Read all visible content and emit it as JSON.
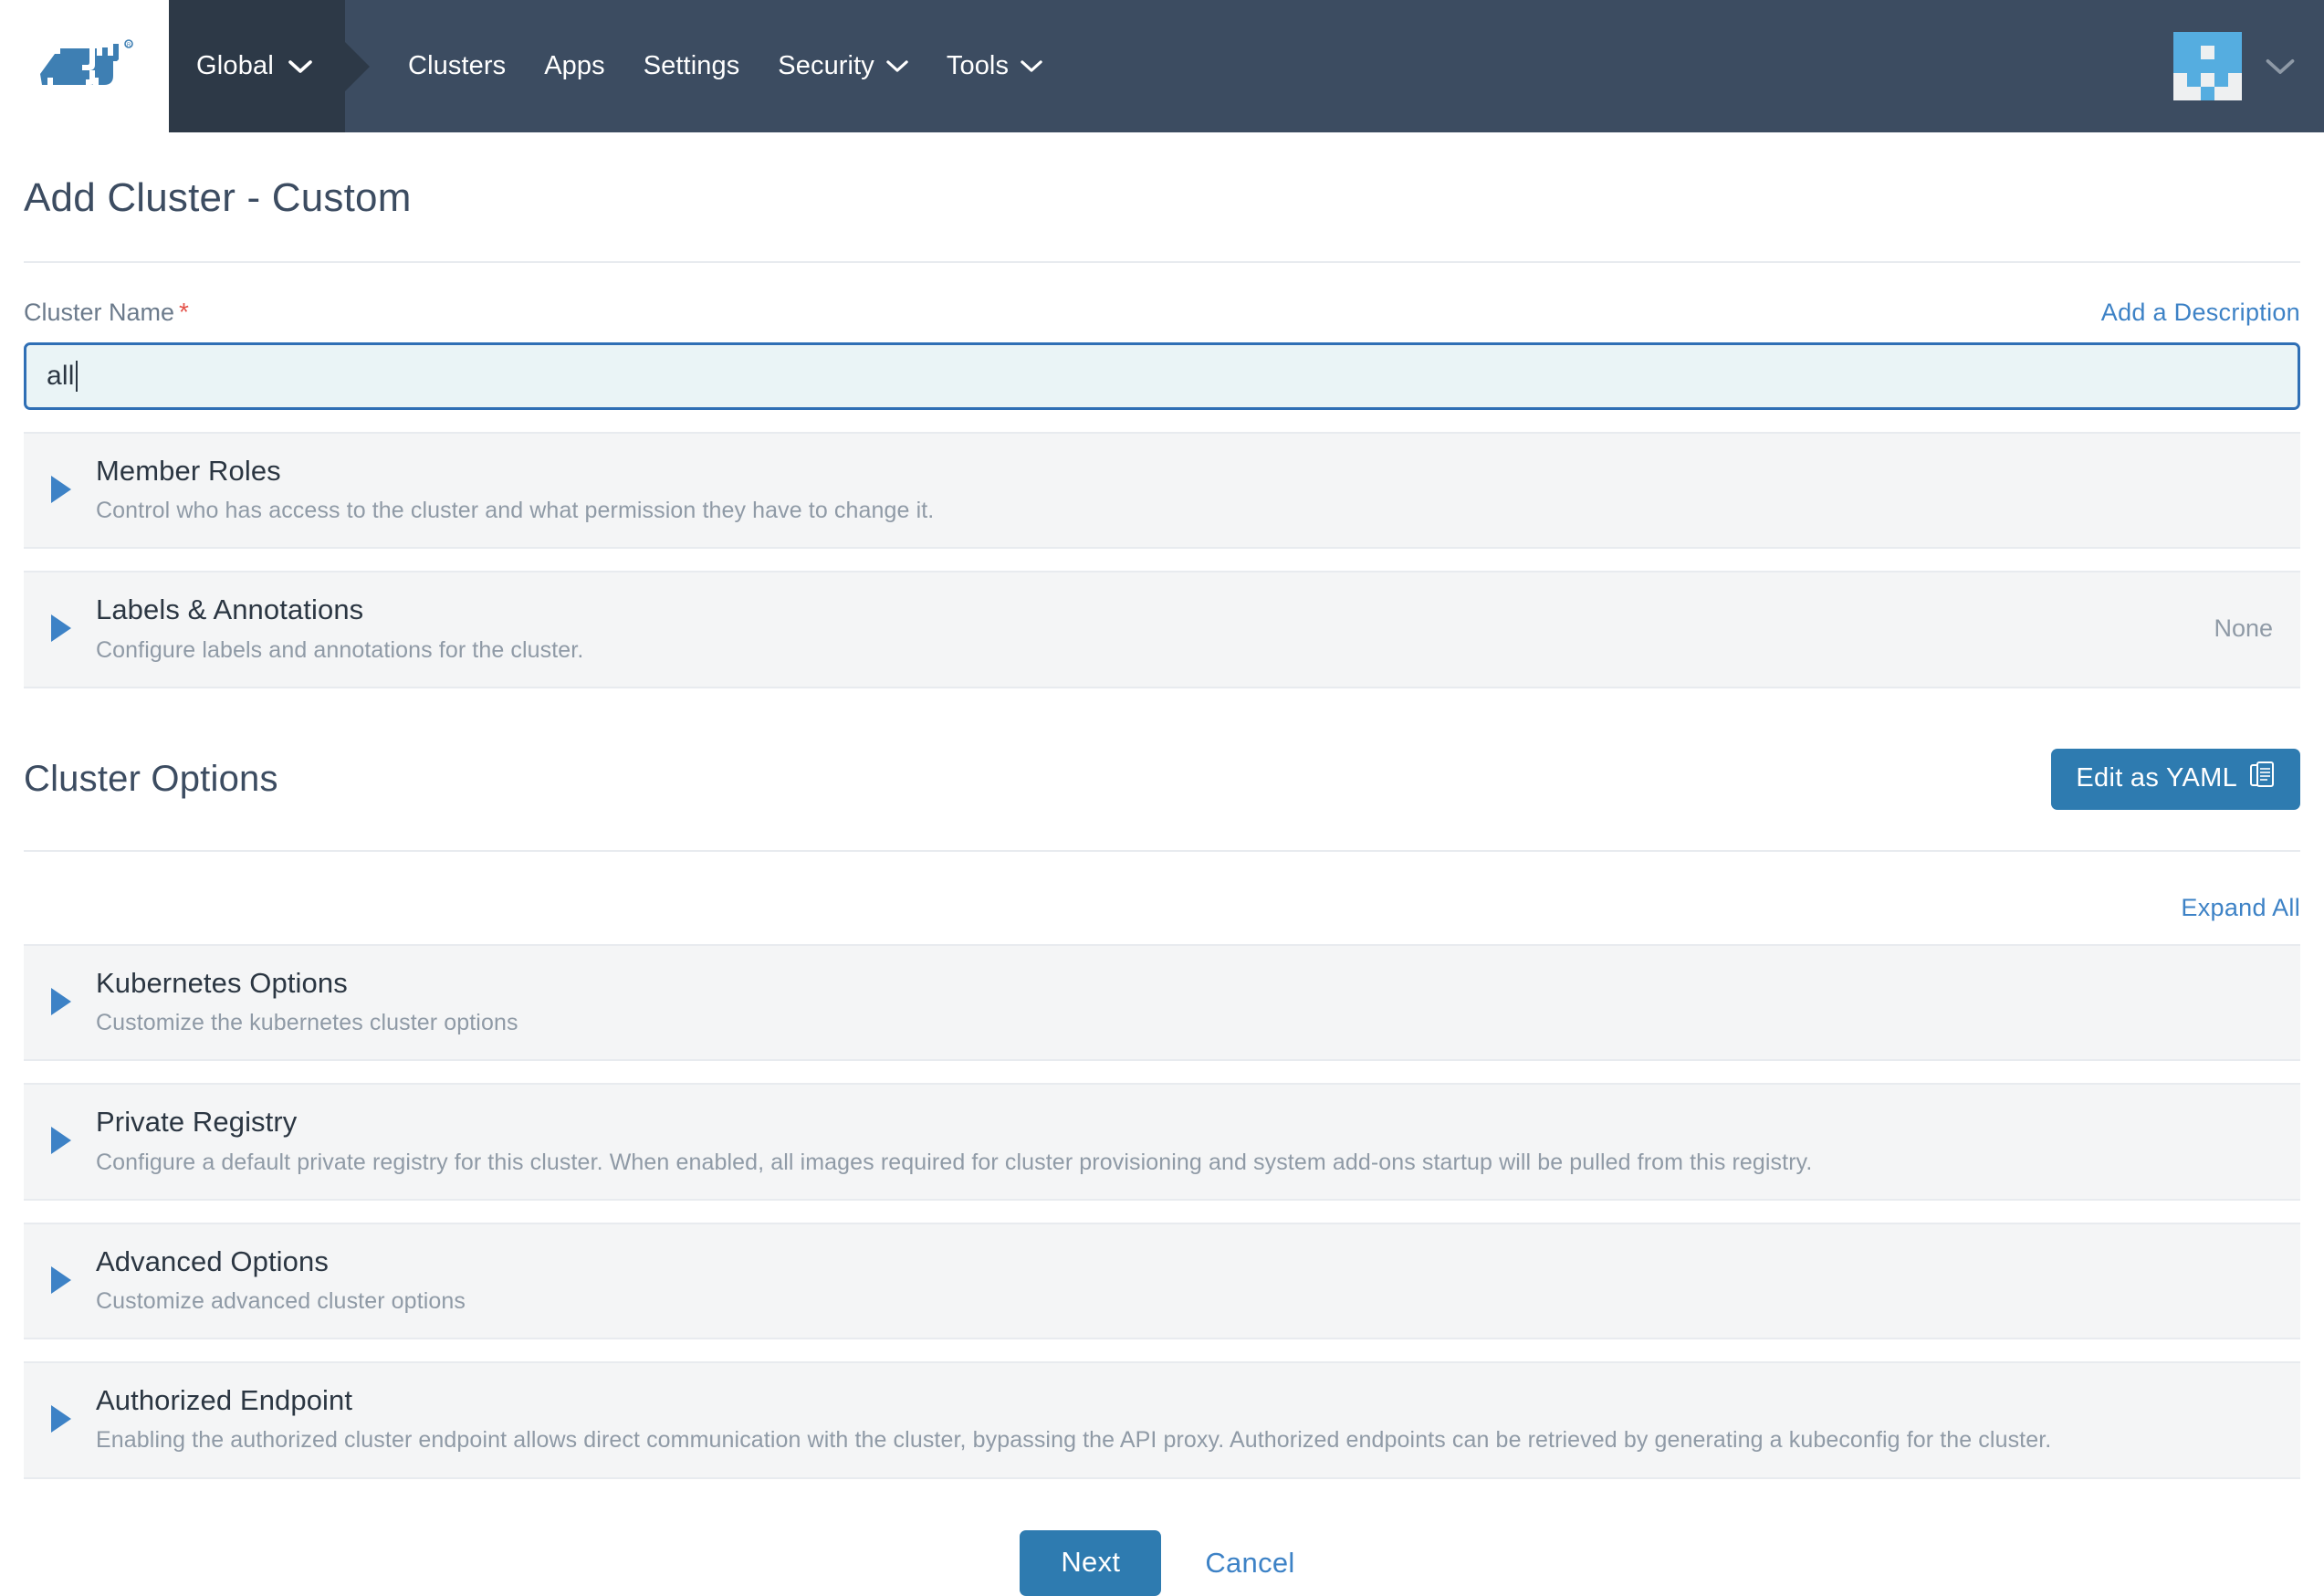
{
  "nav": {
    "logo_icon": "rancher-cow-logo",
    "scope": {
      "label": "Global",
      "caret_icon": "chevron-down-icon"
    },
    "items": [
      {
        "label": "Clusters",
        "has_caret": false
      },
      {
        "label": "Apps",
        "has_caret": false
      },
      {
        "label": "Settings",
        "has_caret": false
      },
      {
        "label": "Security",
        "has_caret": true
      },
      {
        "label": "Tools",
        "has_caret": true
      }
    ],
    "user": {
      "avatar_icon": "user-identicon-avatar",
      "caret_icon": "chevron-down-icon"
    },
    "colors": {
      "bar": "#3c4c61",
      "scope_bg": "#2d3947",
      "text": "#ffffff"
    }
  },
  "page": {
    "title": "Add Cluster - Custom"
  },
  "cluster_name": {
    "label": "Cluster Name",
    "required_marker": "*",
    "value": "all",
    "placeholder": "",
    "add_description_link": "Add a Description",
    "focus_border_color": "#2f6fb5",
    "focus_bg_color": "#eaf4f6"
  },
  "top_accordions": [
    {
      "title": "Member Roles",
      "description": "Control who has access to the cluster and what permission they have to change it.",
      "right_value": "",
      "toggle_icon": "triangle-right-icon"
    },
    {
      "title": "Labels & Annotations",
      "description": "Configure labels and annotations for the cluster.",
      "right_value": "None",
      "toggle_icon": "triangle-right-icon"
    }
  ],
  "cluster_options": {
    "section_title": "Cluster Options",
    "edit_yaml_label": "Edit as YAML",
    "edit_yaml_icon": "clipboard-icon",
    "expand_all_label": "Expand All",
    "accordions": [
      {
        "title": "Kubernetes Options",
        "description": "Customize the kubernetes cluster options",
        "right_value": "",
        "toggle_icon": "triangle-right-icon"
      },
      {
        "title": "Private Registry",
        "description": "Configure a default private registry for this cluster. When enabled, all images required for cluster provisioning and system add-ons startup will be pulled from this registry.",
        "right_value": "",
        "toggle_icon": "triangle-right-icon"
      },
      {
        "title": "Advanced Options",
        "description": "Customize advanced cluster options",
        "right_value": "",
        "toggle_icon": "triangle-right-icon"
      },
      {
        "title": "Authorized Endpoint",
        "description": "Enabling the authorized cluster endpoint allows direct communication with the cluster, bypassing the API proxy. Authorized endpoints can be retrieved by generating a kubeconfig for the cluster.",
        "right_value": "",
        "toggle_icon": "triangle-right-icon"
      }
    ]
  },
  "footer": {
    "next_label": "Next",
    "cancel_label": "Cancel",
    "primary_color": "#2e7bb0",
    "link_color": "#3d82c6"
  }
}
